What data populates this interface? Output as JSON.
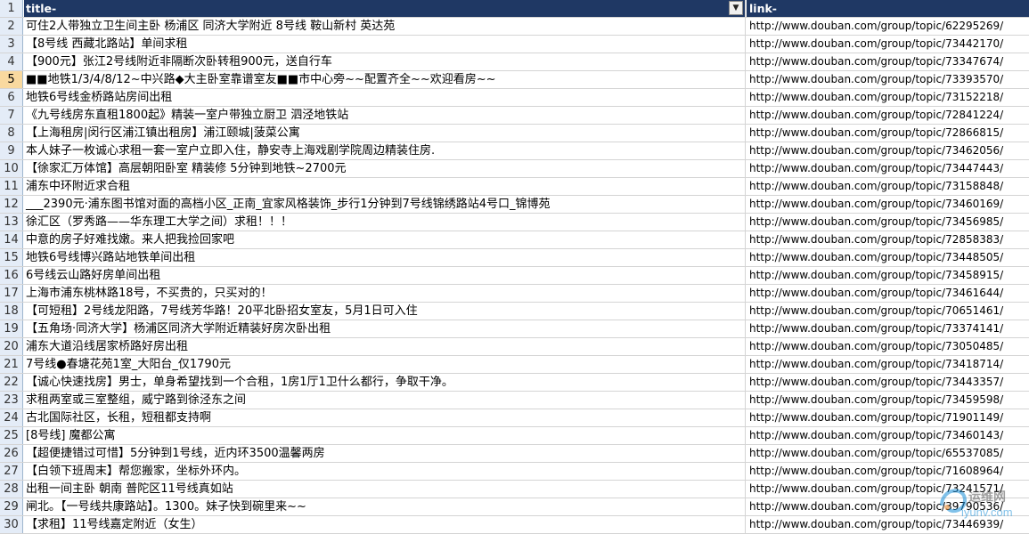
{
  "header": {
    "rownum": "1",
    "col_a": "title-",
    "col_b": "link-",
    "filter_glyph": "▼"
  },
  "rows": [
    {
      "n": "2",
      "title": "可住2人带独立卫生间主卧 杨浦区 同济大学附近 8号线 鞍山新村 英达苑",
      "link": "http://www.douban.com/group/topic/62295269/"
    },
    {
      "n": "3",
      "title": "【8号线 西藏北路站】单间求租",
      "link": "http://www.douban.com/group/topic/73442170/"
    },
    {
      "n": "4",
      "title": "【900元】张江2号线附近非隔断次卧转租900元，送自行车",
      "link": "http://www.douban.com/group/topic/73347674/"
    },
    {
      "n": "5",
      "title": "■■地铁1/3/4/8/12~中兴路◆大主卧室靠谱室友■■市中心旁~~配置齐全~~欢迎看房~~",
      "link": "http://www.douban.com/group/topic/73393570/"
    },
    {
      "n": "6",
      "title": "地铁6号线金桥路站房间出租",
      "link": "http://www.douban.com/group/topic/73152218/"
    },
    {
      "n": "7",
      "title": "《九号线房东直租1800起》精装一室户带独立厨卫 泗泾地铁站",
      "link": "http://www.douban.com/group/topic/72841224/"
    },
    {
      "n": "8",
      "title": "【上海租房|闵行区浦江镇出租房】浦江颐城|菠菜公寓",
      "link": "http://www.douban.com/group/topic/72866815/"
    },
    {
      "n": "9",
      "title": "本人妹子一枚诚心求租一套一室户立即入住，静安寺上海戏剧学院周边精装住房.",
      "link": "http://www.douban.com/group/topic/73462056/"
    },
    {
      "n": "10",
      "title": "【徐家汇万体馆】高层朝阳卧室 精装修 5分钟到地铁~2700元",
      "link": "http://www.douban.com/group/topic/73447443/"
    },
    {
      "n": "11",
      "title": "浦东中环附近求合租",
      "link": "http://www.douban.com/group/topic/73158848/"
    },
    {
      "n": "12",
      "title": "___2390元·浦东图书馆对面的高档小区_正南_宜家风格装饰_步行1分钟到7号线锦绣路站4号口_锦博苑",
      "link": "http://www.douban.com/group/topic/73460169/"
    },
    {
      "n": "13",
      "title": "徐汇区（罗秀路——华东理工大学之间）求租！！！",
      "link": "http://www.douban.com/group/topic/73456985/"
    },
    {
      "n": "14",
      "title": "中意的房子好难找嫩。来人把我捡回家吧",
      "link": "http://www.douban.com/group/topic/72858383/"
    },
    {
      "n": "15",
      "title": "地铁6号线博兴路站地铁单间出租",
      "link": "http://www.douban.com/group/topic/73448505/"
    },
    {
      "n": "16",
      "title": "6号线云山路好房单间出租",
      "link": "http://www.douban.com/group/topic/73458915/"
    },
    {
      "n": "17",
      "title": "上海市浦东桃林路18号，不买贵的，只买对的！",
      "link": "http://www.douban.com/group/topic/73461644/"
    },
    {
      "n": "18",
      "title": "【可短租】2号线龙阳路，7号线芳华路！20平北卧招女室友，5月1日可入住",
      "link": "http://www.douban.com/group/topic/70651461/"
    },
    {
      "n": "19",
      "title": "【五角场·同济大学】杨浦区同济大学附近精装好房次卧出租",
      "link": "http://www.douban.com/group/topic/73374141/"
    },
    {
      "n": "20",
      "title": "浦东大道沿线居家桥路好房出租",
      "link": "http://www.douban.com/group/topic/73050485/"
    },
    {
      "n": "21",
      "title": "7号线●春塘花苑1室_大阳台_仅1790元",
      "link": "http://www.douban.com/group/topic/73418714/"
    },
    {
      "n": "22",
      "title": "【诚心快速找房】男士，单身希望找到一个合租，1房1厅1卫什么都行，争取干净。",
      "link": "http://www.douban.com/group/topic/73443357/"
    },
    {
      "n": "23",
      "title": "求租两室或三室整组，威宁路到徐泾东之间",
      "link": "http://www.douban.com/group/topic/73459598/"
    },
    {
      "n": "24",
      "title": "古北国际社区，长租，短租都支持啊",
      "link": "http://www.douban.com/group/topic/71901149/"
    },
    {
      "n": "25",
      "title": "[8号线] 魔都公寓",
      "link": "http://www.douban.com/group/topic/73460143/"
    },
    {
      "n": "26",
      "title": "【超便捷错过可惜】5分钟到1号线，近内环3500温馨两房",
      "link": "http://www.douban.com/group/topic/65537085/"
    },
    {
      "n": "27",
      "title": "【白领下班周末】帮您搬家，坐标外环内。",
      "link": "http://www.douban.com/group/topic/71608964/"
    },
    {
      "n": "28",
      "title": "出租一间主卧 朝南 普陀区11号线真如站",
      "link": "http://www.douban.com/group/topic/73241571/"
    },
    {
      "n": "29",
      "title": "闸北。【一号线共康路站】。1300。妹子快到碗里来~~",
      "link": "http://www.douban.com/group/topic/39790536/"
    },
    {
      "n": "30",
      "title": "【求租】11号线嘉定附近（女生）",
      "link": "http://www.douban.com/group/topic/73446939/"
    }
  ],
  "selected_row": "5",
  "watermark": {
    "text": "运维网",
    "sub": "iyunv.com"
  }
}
